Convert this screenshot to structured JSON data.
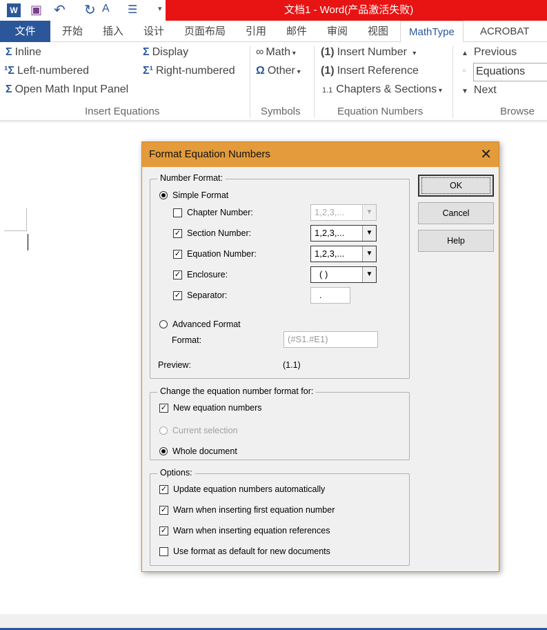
{
  "window": {
    "title": "文档1 -  Word(产品激活失败)"
  },
  "tabs": [
    {
      "label": "文件"
    },
    {
      "label": "开始"
    },
    {
      "label": "插入"
    },
    {
      "label": "设计"
    },
    {
      "label": "页面布局"
    },
    {
      "label": "引用"
    },
    {
      "label": "邮件"
    },
    {
      "label": "审阅"
    },
    {
      "label": "视图"
    },
    {
      "label": "MathType",
      "active": true
    },
    {
      "label": "ACROBAT"
    }
  ],
  "ribbon": {
    "insert_equations": {
      "inline": "Inline",
      "display": "Display",
      "left_numbered": "Left-numbered",
      "right_numbered": "Right-numbered",
      "open_panel": "Open Math Input Panel",
      "label": "Insert Equations"
    },
    "symbols": {
      "math": "Math",
      "other": "Other",
      "label": "Symbols"
    },
    "equation_numbers": {
      "insert_number": "Insert Number",
      "insert_reference": "Insert Reference",
      "chapters_sections": "Chapters & Sections",
      "label": "Equation Numbers"
    },
    "browse": {
      "previous": "Previous",
      "field": "Equations",
      "next": "Next",
      "label": "Browse"
    }
  },
  "dialog": {
    "title": "Format Equation Numbers",
    "number_format": {
      "legend": "Number Format:",
      "simple": "Simple Format",
      "simple_selected": true,
      "chapter": {
        "label": "Chapter Number:",
        "checked": false,
        "value": "1,2,3,..."
      },
      "section": {
        "label": "Section Number:",
        "checked": true,
        "value": "1,2,3,..."
      },
      "equation": {
        "label": "Equation Number:",
        "checked": true,
        "value": "1,2,3,..."
      },
      "enclosure": {
        "label": "Enclosure:",
        "checked": true,
        "value": "( )"
      },
      "separator": {
        "label": "Separator:",
        "checked": true,
        "value": "."
      },
      "advanced": "Advanced Format",
      "format_label": "Format:",
      "format_value": "(#S1.#E1)",
      "preview_label": "Preview:",
      "preview_value": "(1.1)"
    },
    "change_for": {
      "legend": "Change the equation number format for:",
      "new_numbers": "New equation numbers",
      "new_checked": true,
      "current_selection": "Current selection",
      "whole_document": "Whole document"
    },
    "options": {
      "legend": "Options:",
      "items": [
        {
          "label": "Update equation numbers automatically",
          "checked": true
        },
        {
          "label": "Warn when inserting first equation number",
          "checked": true
        },
        {
          "label": "Warn when inserting equation references",
          "checked": true
        },
        {
          "label": "Use format as default for new documents",
          "checked": false
        }
      ]
    },
    "buttons": {
      "ok": "OK",
      "cancel": "Cancel",
      "help": "Help"
    }
  },
  "colors": {
    "title_bar": "#e81313",
    "dialog_title": "#e39b3b",
    "accent": "#2b579a"
  }
}
